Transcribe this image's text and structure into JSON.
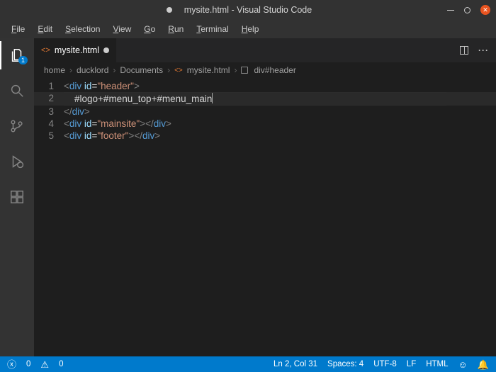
{
  "window": {
    "title": "mysite.html - Visual Studio Code"
  },
  "menu": {
    "file": "File",
    "edit": "Edit",
    "selection": "Selection",
    "view": "View",
    "go": "Go",
    "run": "Run",
    "terminal": "Terminal",
    "help": "Help"
  },
  "activity": {
    "explorer_badge": "1"
  },
  "tabs": {
    "active": "mysite.html"
  },
  "breadcrumb": {
    "p0": "home",
    "p1": "ducklord",
    "p2": "Documents",
    "file": "mysite.html",
    "node": "div#header"
  },
  "code": {
    "ln1": "1",
    "ln2": "2",
    "ln3": "3",
    "ln4": "4",
    "ln5": "5",
    "l1_tag": "div",
    "l1_attr": "id",
    "l1_val": "\"header\"",
    "l2_text": "#logo+#menu_top+#menu_main",
    "l3_tag": "div",
    "l4_tag": "div",
    "l4_attr": "id",
    "l4_val": "\"mainsite\"",
    "l4_ctag": "div",
    "l5_tag": "div",
    "l5_attr": "id",
    "l5_val": "\"footer\"",
    "l5_ctag": "div"
  },
  "status": {
    "errors": "0",
    "warnings": "0",
    "pos": "Ln 2, Col 31",
    "spaces": "Spaces: 4",
    "encoding": "UTF-8",
    "eol": "LF",
    "lang": "HTML"
  }
}
